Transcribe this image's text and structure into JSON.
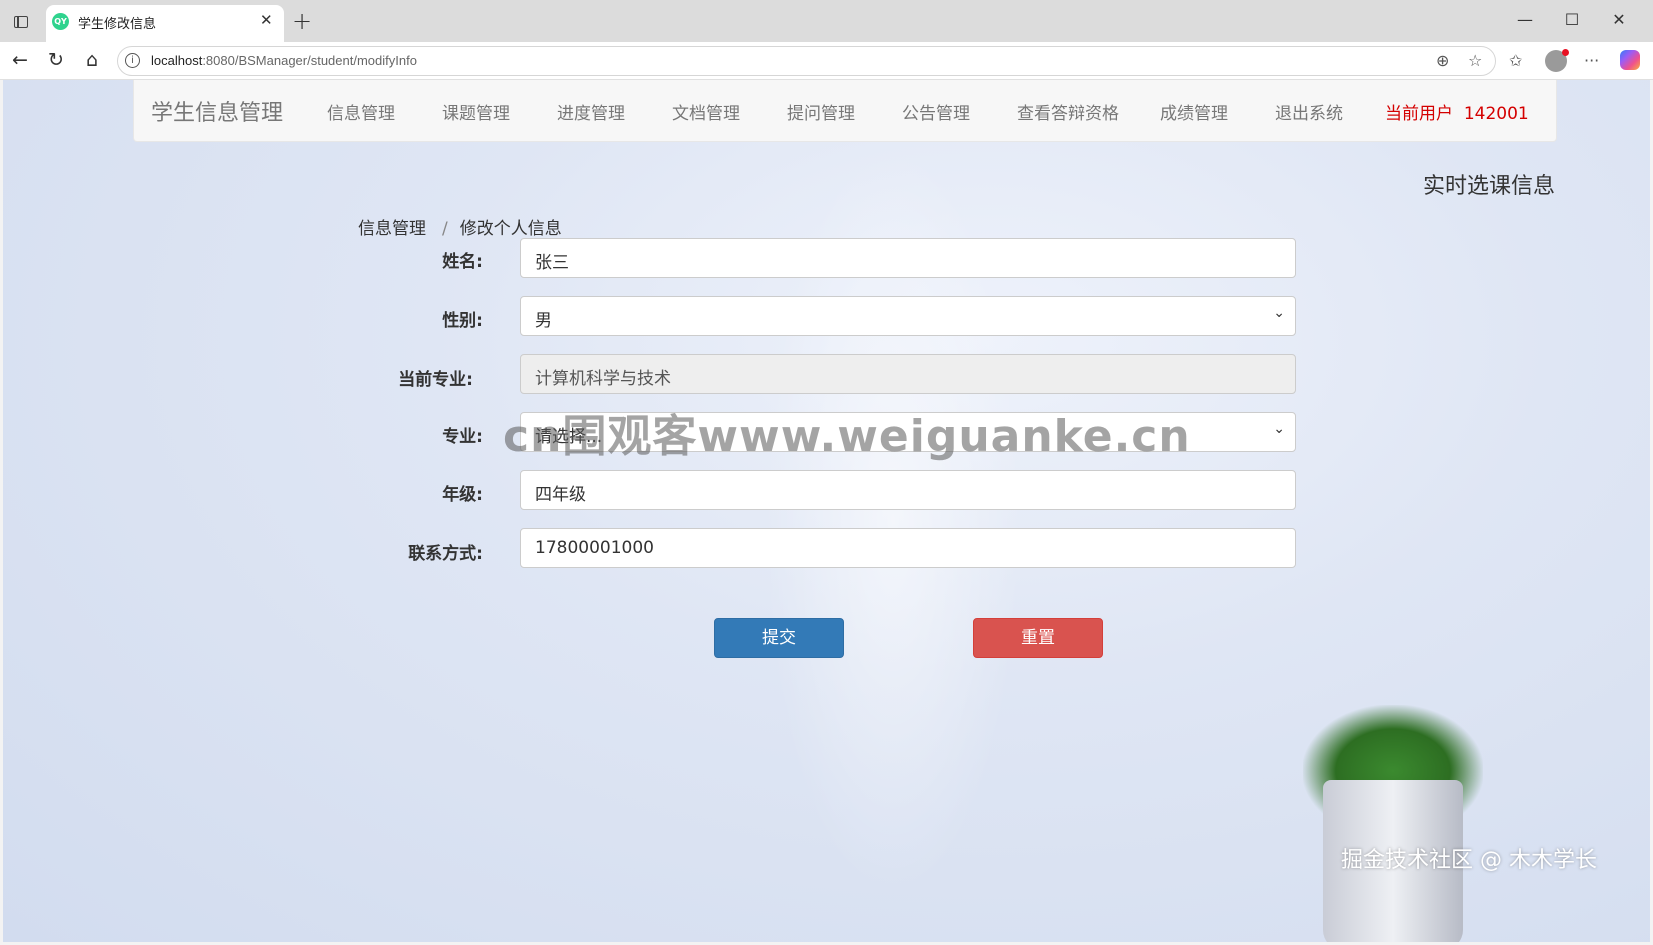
{
  "browser": {
    "tab_title": "学生修改信息",
    "favicon_text": "QY",
    "url_host": "localhost",
    "url_path": ":8080/BSManager/student/modifyInfo"
  },
  "navbar": {
    "brand": "学生信息管理",
    "items": [
      "信息管理",
      "课题管理",
      "进度管理",
      "文档管理",
      "提问管理",
      "公告管理",
      "查看答辩资格",
      "成绩管理",
      "退出系统"
    ],
    "user_label": "当前用户",
    "user_id": "142001"
  },
  "side_title": "实时选课信息",
  "breadcrumb": {
    "parent": "信息管理",
    "separator": "/",
    "current": "修改个人信息"
  },
  "form": {
    "name_label": "姓名:",
    "name_value": "张三",
    "gender_label": "性别:",
    "gender_value": "男",
    "current_major_label": "当前专业:",
    "current_major_value": "计算机科学与技术",
    "major_label": "专业:",
    "major_placeholder": "请选择...",
    "grade_label": "年级:",
    "grade_value": "四年级",
    "contact_label": "联系方式:",
    "contact_value": "17800001000",
    "submit_label": "提交",
    "reset_label": "重置"
  },
  "overlay": {
    "watermark": "cn围观客www.weiguanke.cn",
    "credit": "掘金技术社区 @ 木木学长"
  },
  "colors": {
    "primary": "#337ab7",
    "danger": "#d9534f",
    "user_highlight": "#d40000"
  }
}
